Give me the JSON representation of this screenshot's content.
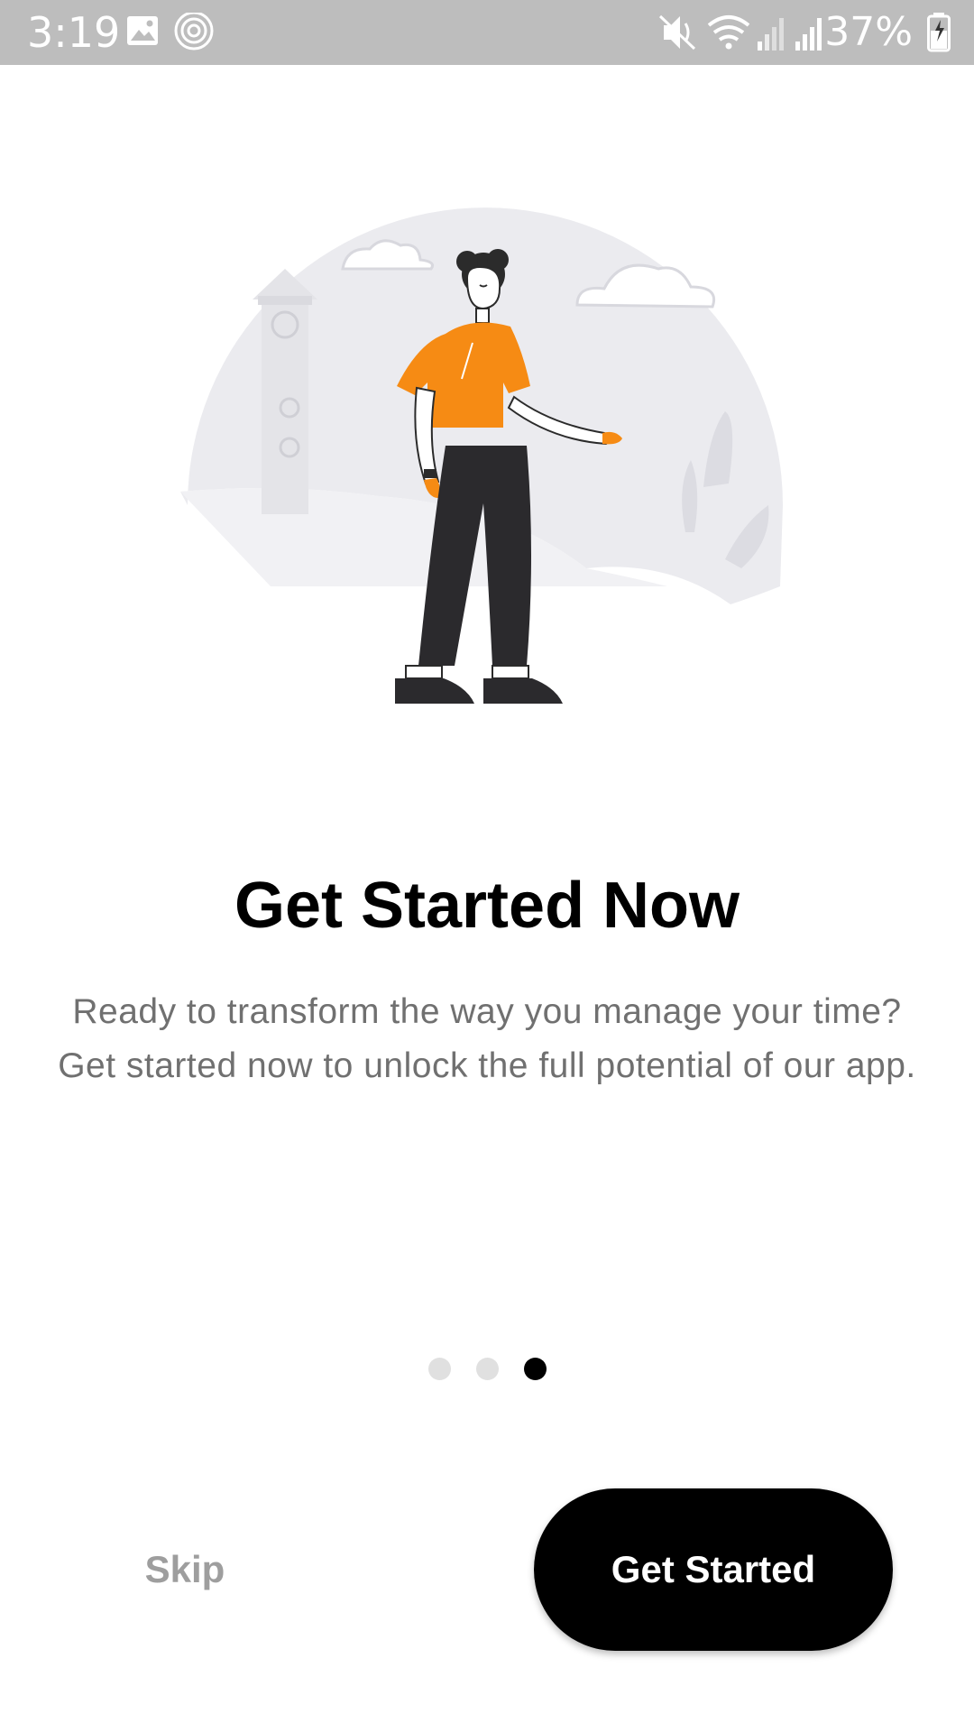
{
  "status_bar": {
    "time": "3:19",
    "battery": "37%",
    "icons": [
      "gallery-icon",
      "shazam-icon",
      "mute-vibrate-icon",
      "wifi-icon",
      "signal-icon",
      "signal-icon",
      "battery-charging-icon"
    ]
  },
  "onboarding": {
    "title": "Get Started Now",
    "description": "Ready to transform the way you manage your time? Get started now to unlock the full potential of our app.",
    "page_count": 3,
    "current_page": 3
  },
  "actions": {
    "skip_label": "Skip",
    "primary_label": "Get Started"
  },
  "colors": {
    "accent": "#F68B14",
    "primary_button": "#000000",
    "skip_text": "#9E9E9E",
    "description_text": "#707070",
    "dot_inactive": "#E0E0E0",
    "dot_active": "#000000"
  }
}
